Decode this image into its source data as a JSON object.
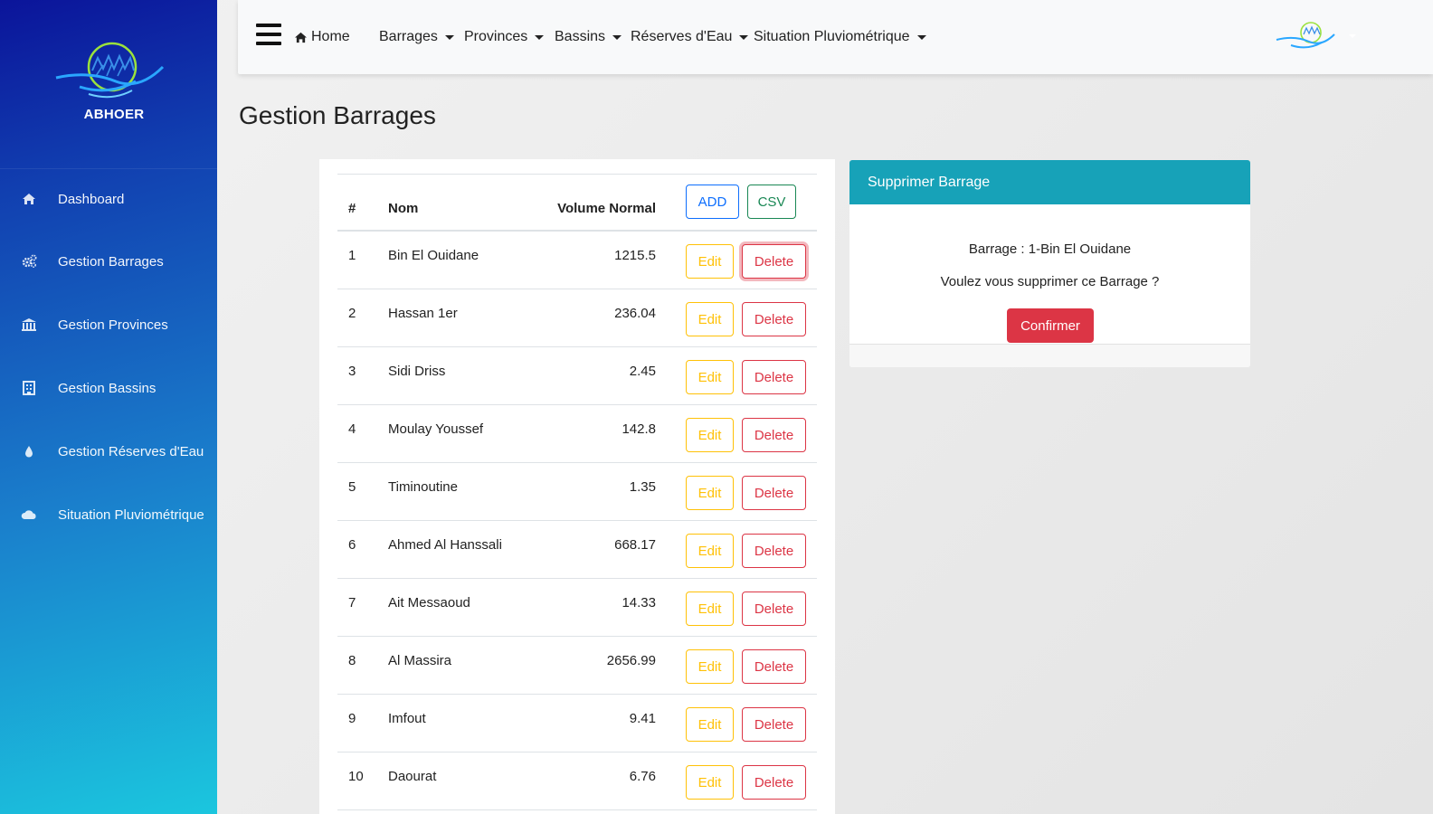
{
  "sidebar": {
    "brand_name": "ABHOER",
    "items": [
      {
        "label": "Dashboard",
        "icon": "home-icon"
      },
      {
        "label": "Gestion Barrages",
        "icon": "cogs-icon"
      },
      {
        "label": "Gestion Provinces",
        "icon": "bank-icon"
      },
      {
        "label": "Gestion Bassins",
        "icon": "building-icon"
      },
      {
        "label": "Gestion Réserves d'Eau",
        "icon": "water-drop-icon"
      },
      {
        "label": "Situation Pluviométrique",
        "icon": "cloud-icon"
      }
    ]
  },
  "topbar": {
    "home_label": "Home",
    "menus": [
      "Barrages",
      "Provinces",
      "Bassins",
      "Réserves d'Eau",
      "Situation Pluviométrique"
    ]
  },
  "page_title": "Gestion Barrages",
  "table": {
    "headers": {
      "index": "#",
      "name": "Nom",
      "volume": "Volume Normal"
    },
    "add_label": "ADD",
    "csv_label": "CSV",
    "edit_label": "Edit",
    "delete_label": "Delete",
    "rows": [
      {
        "index": "1",
        "name": "Bin El Ouidane",
        "volume": "1215.5"
      },
      {
        "index": "2",
        "name": "Hassan 1er",
        "volume": "236.04"
      },
      {
        "index": "3",
        "name": "Sidi Driss",
        "volume": "2.45"
      },
      {
        "index": "4",
        "name": "Moulay Youssef",
        "volume": "142.8"
      },
      {
        "index": "5",
        "name": "Timinoutine",
        "volume": "1.35"
      },
      {
        "index": "6",
        "name": "Ahmed Al Hanssali",
        "volume": "668.17"
      },
      {
        "index": "7",
        "name": "Ait Messaoud",
        "volume": "14.33"
      },
      {
        "index": "8",
        "name": "Al Massira",
        "volume": "2656.99"
      },
      {
        "index": "9",
        "name": "Imfout",
        "volume": "9.41"
      },
      {
        "index": "10",
        "name": "Daourat",
        "volume": "6.76"
      }
    ]
  },
  "delete_panel": {
    "header": "Supprimer Barrage",
    "barrage_line": "Barrage : 1-Bin El Ouidane",
    "question": "Voulez vous supprimer ce Barrage ?",
    "confirm_label": "Confirmer"
  },
  "colors": {
    "sidebar_top": "#0b149a",
    "sidebar_bottom": "#1bc6de",
    "panel_header": "#17a2b8",
    "danger": "#dc3545",
    "warning": "#ffc107",
    "primary": "#0d6efd",
    "success": "#198754"
  }
}
